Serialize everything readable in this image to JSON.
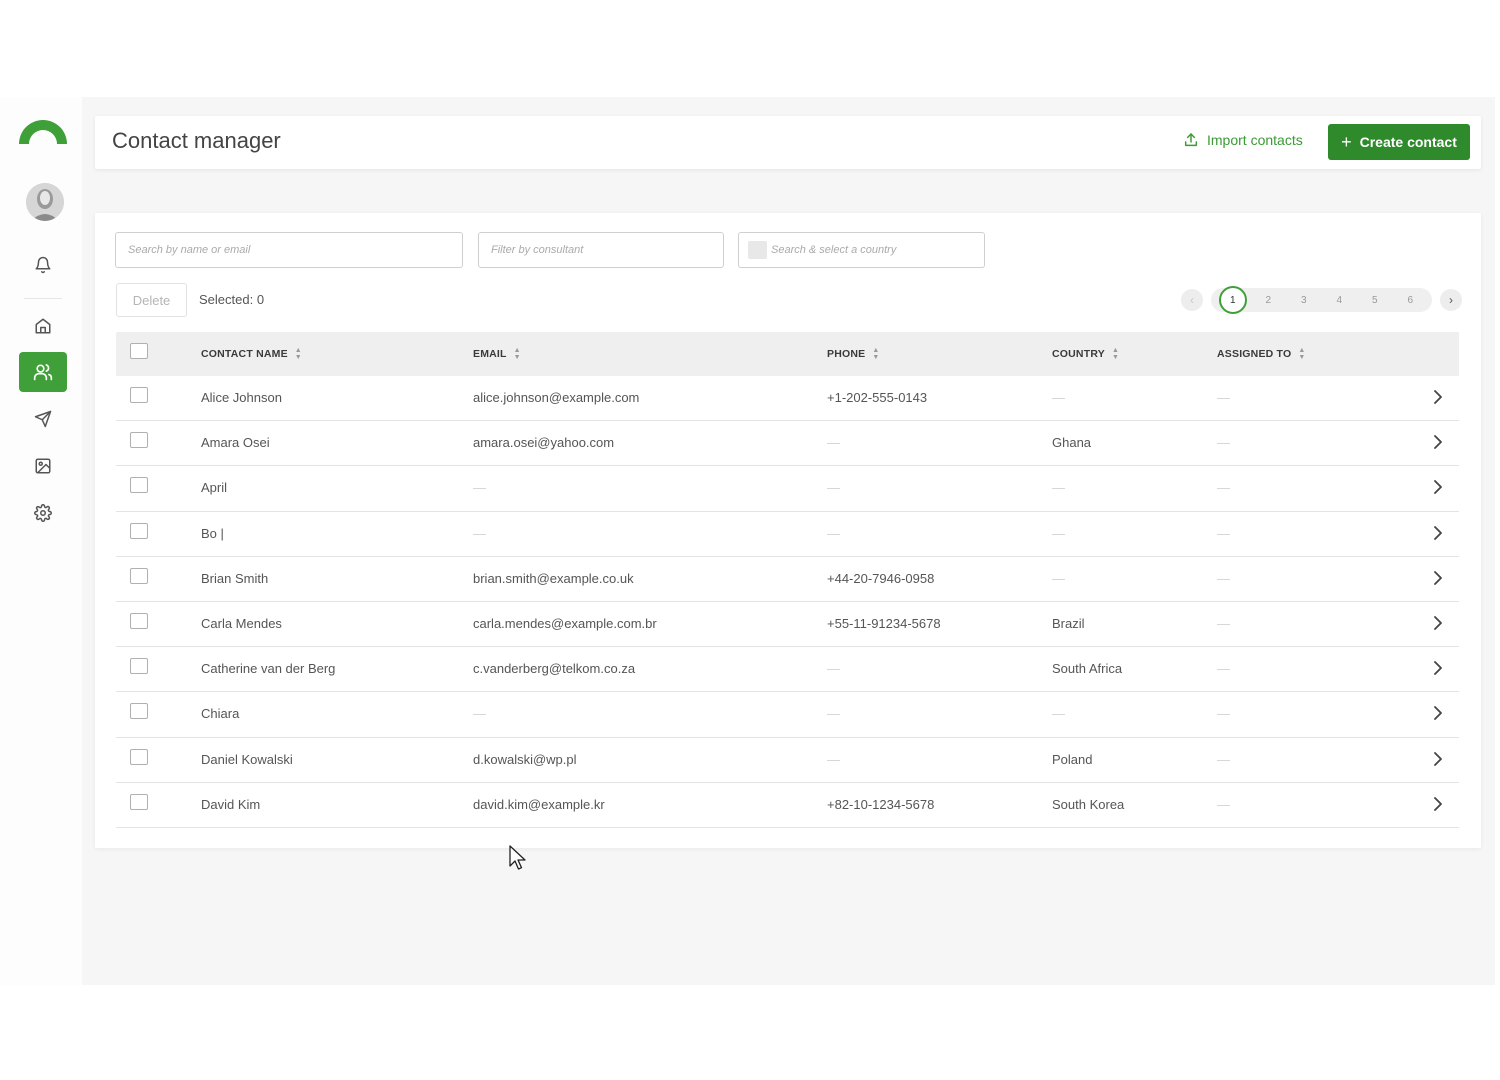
{
  "header": {
    "title": "Contact manager",
    "import_label": "Import contacts",
    "create_label": "Create contact"
  },
  "filters": {
    "search_placeholder": "Search by name or email",
    "consultant_placeholder": "Filter by consultant",
    "country_placeholder": "Search & select a country"
  },
  "toolbar": {
    "delete_label": "Delete",
    "selected_text": "Selected: 0"
  },
  "pagination": {
    "pages": [
      "1",
      "2",
      "3",
      "4",
      "5",
      "6"
    ],
    "current": "1"
  },
  "table": {
    "columns": {
      "name": "CONTACT NAME",
      "email": "EMAIL",
      "phone": "PHONE",
      "country": "COUNTRY",
      "assigned": "ASSIGNED TO"
    },
    "rows": [
      {
        "name": "Alice Johnson",
        "email": "alice.johnson@example.com",
        "phone": "+1-202-555-0143",
        "country": "—",
        "assigned": "—"
      },
      {
        "name": "Amara Osei",
        "email": "amara.osei@yahoo.com",
        "phone": "—",
        "country": "Ghana",
        "assigned": "—"
      },
      {
        "name": "April",
        "email": "—",
        "phone": "—",
        "country": "—",
        "assigned": "—"
      },
      {
        "name": "Bo |",
        "email": "—",
        "phone": "—",
        "country": "—",
        "assigned": "—"
      },
      {
        "name": "Brian Smith",
        "email": "brian.smith@example.co.uk",
        "phone": "+44-20-7946-0958",
        "country": "—",
        "assigned": "—"
      },
      {
        "name": "Carla Mendes",
        "email": "carla.mendes@example.com.br",
        "phone": "+55-11-91234-5678",
        "country": "Brazil",
        "assigned": "—"
      },
      {
        "name": "Catherine van der Berg",
        "email": "c.vanderberg@telkom.co.za",
        "phone": "—",
        "country": "South Africa",
        "assigned": "—"
      },
      {
        "name": "Chiara",
        "email": "—",
        "phone": "—",
        "country": "—",
        "assigned": "—"
      },
      {
        "name": "Daniel Kowalski",
        "email": "d.kowalski@wp.pl",
        "phone": "—",
        "country": "Poland",
        "assigned": "—"
      },
      {
        "name": "David Kim",
        "email": "david.kim@example.kr",
        "phone": "+82-10-1234-5678",
        "country": "South Korea",
        "assigned": "—"
      }
    ]
  },
  "colors": {
    "accent": "#3fa03a",
    "primary_button": "#2e8a2a"
  },
  "icons": {
    "sidebar": [
      "bell-icon",
      "home-icon",
      "contacts-icon",
      "send-icon",
      "image-icon",
      "settings-icon"
    ]
  }
}
